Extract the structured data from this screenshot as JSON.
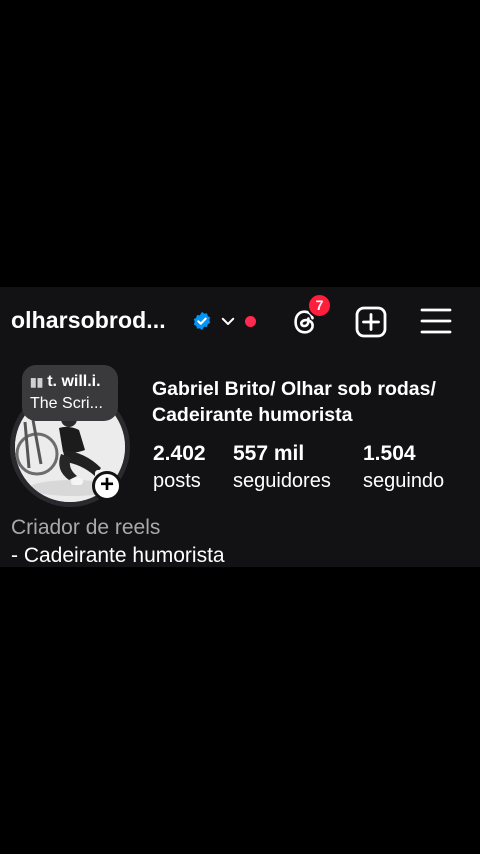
{
  "header": {
    "username": "olharsobrod...",
    "threads_badge": "7"
  },
  "note": {
    "line1": "t. will.i.",
    "line2": "The Scri..."
  },
  "profile": {
    "full_name": "Gabriel Brito/ Olhar sob rodas/ Cadeirante humorista",
    "category": "Criador de reels",
    "bio": "- Cadeirante humorista"
  },
  "stats": [
    {
      "value": "2.402",
      "label": "posts"
    },
    {
      "value": "557 mil",
      "label": "seguidores"
    },
    {
      "value": "1.504",
      "label": "seguindo"
    }
  ],
  "icons": {
    "verified": "verified-badge-icon",
    "dropdown": "chevron-down-icon",
    "threads": "threads-icon",
    "create": "plus-square-icon",
    "menu": "hamburger-menu-icon"
  },
  "colors": {
    "background": "#000000",
    "panel": "#121215",
    "verified": "#0095f6",
    "notification": "#ff1f3d"
  }
}
